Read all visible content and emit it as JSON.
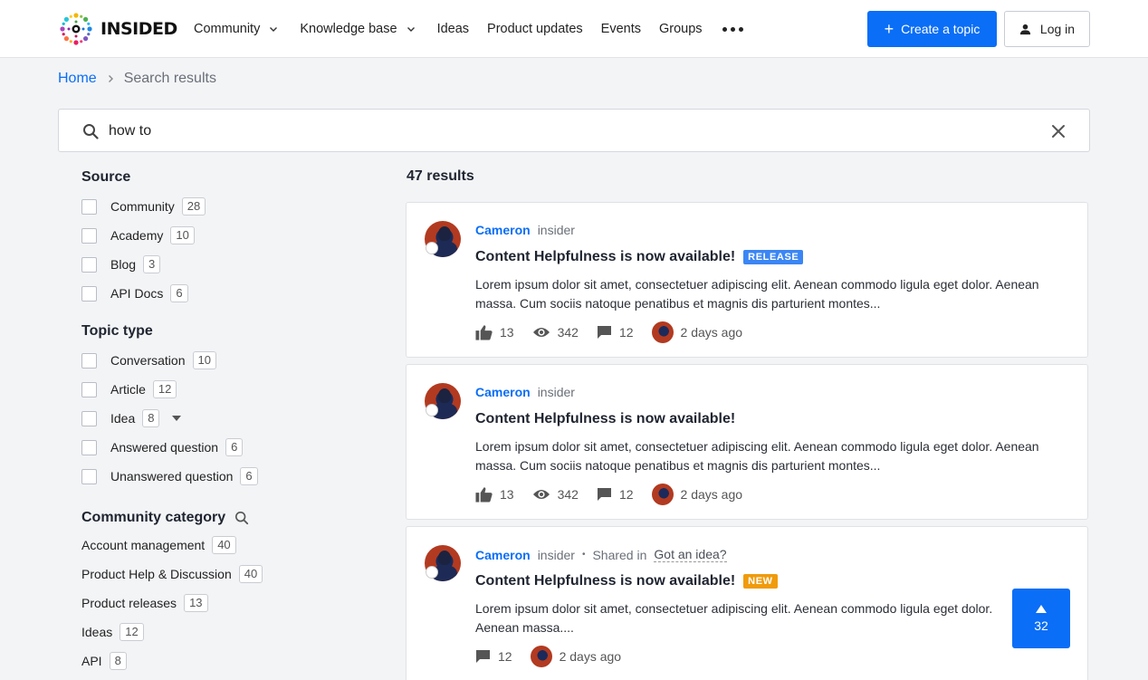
{
  "header": {
    "logo_text": "INSIDED",
    "nav": [
      {
        "label": "Community",
        "dropdown": true
      },
      {
        "label": "Knowledge base",
        "dropdown": true
      },
      {
        "label": "Ideas",
        "dropdown": false
      },
      {
        "label": "Product updates",
        "dropdown": false
      },
      {
        "label": "Events",
        "dropdown": false
      },
      {
        "label": "Groups",
        "dropdown": false
      }
    ],
    "create_label": "Create a topic",
    "login_label": "Log in"
  },
  "breadcrumb": {
    "home": "Home",
    "current": "Search results"
  },
  "search": {
    "value": "how to"
  },
  "sidebar": {
    "source": {
      "title": "Source",
      "items": [
        {
          "label": "Community",
          "count": "28"
        },
        {
          "label": "Academy",
          "count": "10"
        },
        {
          "label": "Blog",
          "count": "3"
        },
        {
          "label": "API Docs",
          "count": "6"
        }
      ]
    },
    "topic_type": {
      "title": "Topic type",
      "items": [
        {
          "label": "Conversation",
          "count": "10"
        },
        {
          "label": "Article",
          "count": "12"
        },
        {
          "label": "Idea",
          "count": "8"
        },
        {
          "label": "Answered question",
          "count": "6"
        },
        {
          "label": "Unanswered question",
          "count": "6"
        }
      ]
    },
    "category": {
      "title": "Community category",
      "items": [
        {
          "label": "Account management",
          "count": "40"
        },
        {
          "label": "Product Help & Discussion",
          "count": "40"
        },
        {
          "label": "Product releases",
          "count": "13"
        },
        {
          "label": "Ideas",
          "count": "12"
        },
        {
          "label": "API",
          "count": "8"
        }
      ]
    }
  },
  "results": {
    "count_label": "47 results",
    "items": [
      {
        "author": "Cameron",
        "role": "insider",
        "title": "Content Helpfulness is now available!",
        "tag": "RELEASE",
        "excerpt": "Lorem ipsum dolor sit amet, consectetuer adipiscing elit. Aenean commodo ligula eget dolor. Aenean massa. Cum sociis natoque penatibus et magnis dis parturient montes...",
        "likes": "13",
        "views": "342",
        "comments": "12",
        "time": "2 days ago"
      },
      {
        "author": "Cameron",
        "role": "insider",
        "title": "Content Helpfulness is now available!",
        "excerpt": "Lorem ipsum dolor sit amet, consectetuer adipiscing elit. Aenean commodo ligula eget dolor. Aenean massa. Cum sociis natoque penatibus et magnis dis parturient montes...",
        "likes": "13",
        "views": "342",
        "comments": "12",
        "time": "2 days ago"
      },
      {
        "author": "Cameron",
        "role": "insider",
        "shared_prefix": "Shared in",
        "shared_in": "Got an idea?",
        "title": "Content Helpfulness is now available!",
        "tag": "NEW",
        "excerpt": "Lorem ipsum dolor sit amet, consectetuer adipiscing elit. Aenean commodo ligula eget dolor. Aenean massa....",
        "comments": "12",
        "time": "2 days ago",
        "votes": "32"
      }
    ]
  },
  "colors": {
    "accent": "#0a6ef6",
    "release": "#3b86f4",
    "new": "#f09b0c"
  }
}
